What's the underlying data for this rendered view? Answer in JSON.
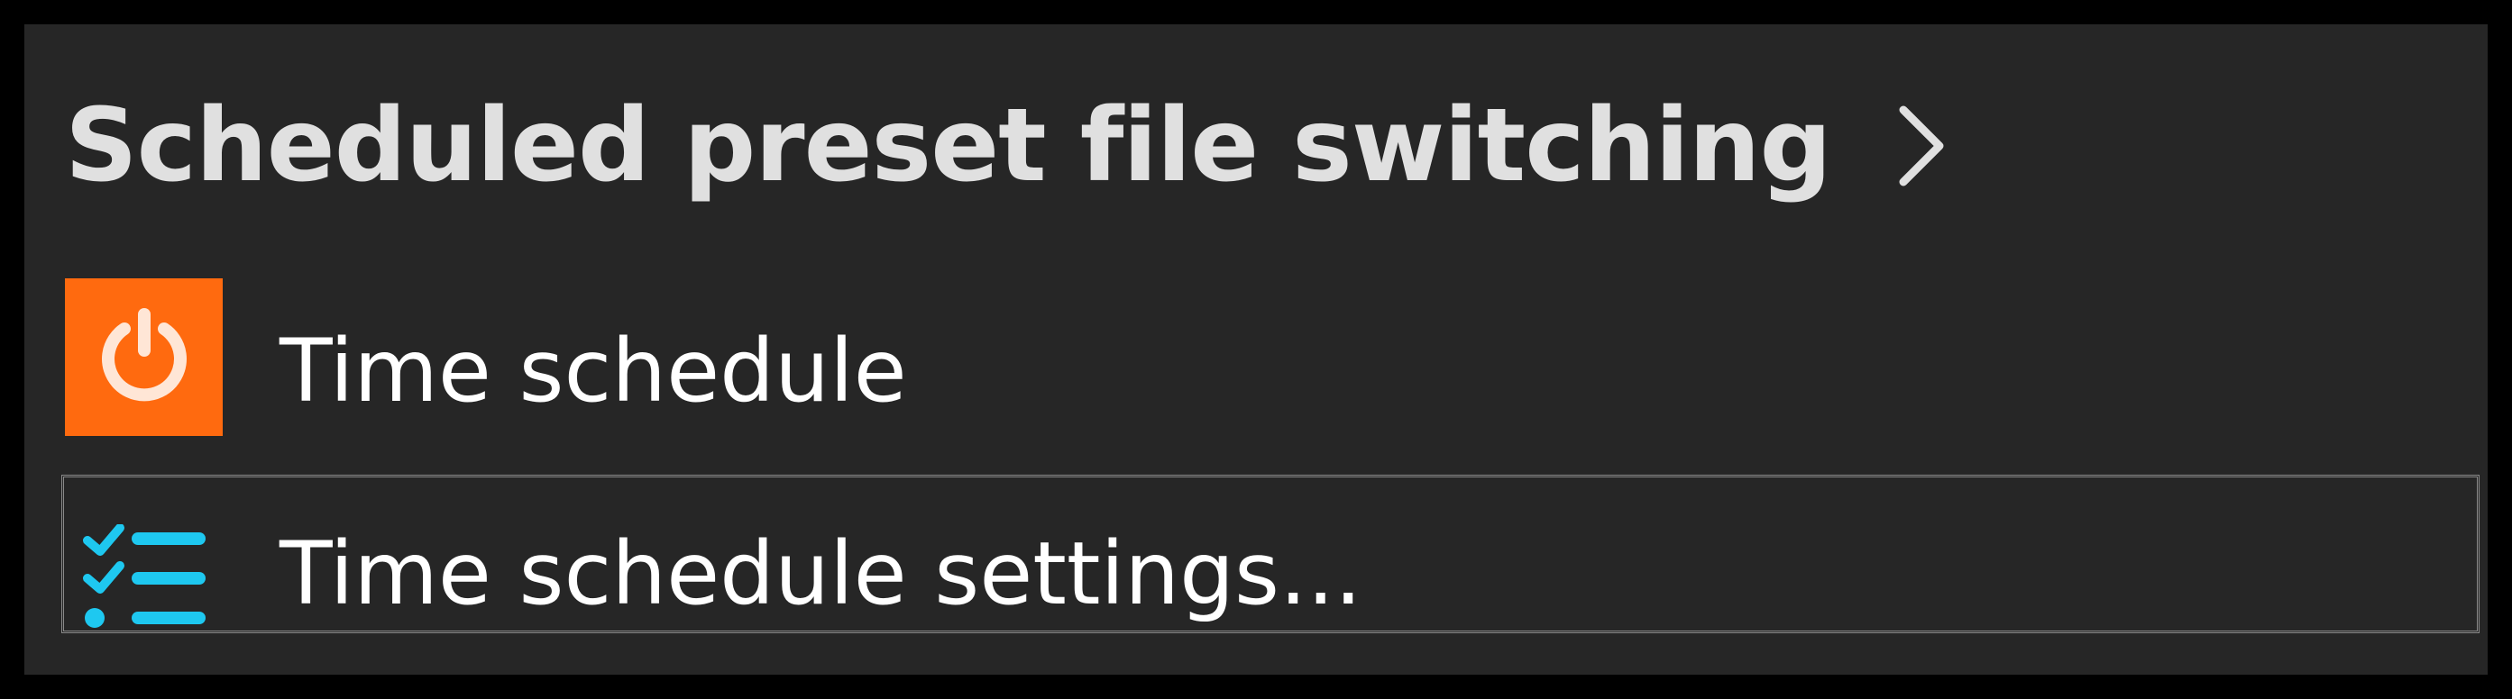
{
  "header": {
    "title": "Scheduled preset file switching",
    "chevron_icon": "chevron-right-icon"
  },
  "items": [
    {
      "label": "Time schedule",
      "icon": "power-icon",
      "icon_color": "#ff6a0f"
    },
    {
      "label": "Time schedule settings...",
      "icon": "checklist-icon",
      "icon_color": "#1ec8f0",
      "focused": true
    }
  ]
}
